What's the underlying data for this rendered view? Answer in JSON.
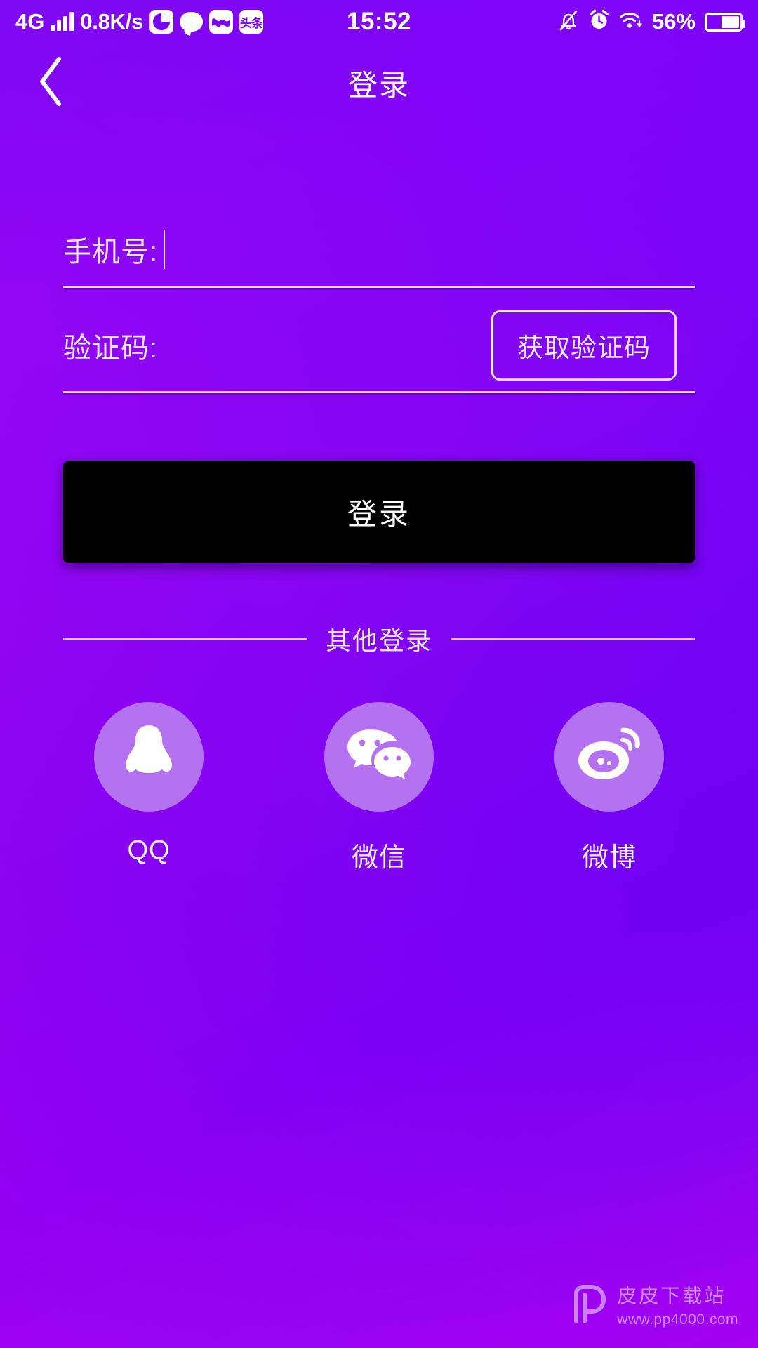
{
  "status_bar": {
    "network_type": "4G",
    "signal_icon": "signal-bars-icon",
    "data_speed": "0.8K/s",
    "app_icons": [
      {
        "name": "speedometer-app-icon",
        "label": ""
      },
      {
        "name": "chat-bubble-app-icon",
        "label": ""
      },
      {
        "name": "zigzag-app-icon",
        "label": ""
      },
      {
        "name": "toutiao-app-icon",
        "label": "头条"
      }
    ],
    "time": "15:52",
    "silent_icon": "bell-muted-icon",
    "alarm_icon": "alarm-clock-icon",
    "wifi_icon": "wifi-icon",
    "battery_percent": "56%",
    "battery_icon": "battery-icon",
    "battery_level": 56
  },
  "header": {
    "back_icon": "back-chevron-icon",
    "title": "登录"
  },
  "form": {
    "phone": {
      "label": "手机号:",
      "value": "",
      "placeholder": ""
    },
    "code": {
      "label": "验证码:",
      "value": "",
      "placeholder": "",
      "get_code_button": "获取验证码"
    },
    "submit_button": "登录"
  },
  "other_login": {
    "divider_text": "其他登录",
    "items": [
      {
        "id": "qq",
        "label": "QQ",
        "icon": "qq-penguin-icon"
      },
      {
        "id": "wechat",
        "label": "微信",
        "icon": "wechat-icon"
      },
      {
        "id": "weibo",
        "label": "微博",
        "icon": "weibo-icon"
      }
    ]
  },
  "watermark": {
    "logo_icon": "pp-logo-icon",
    "site_name": "皮皮下载站",
    "url": "www.pp4000.com"
  },
  "colors": {
    "bg_top": "#6C00F4",
    "bg_bottom": "#A300F0",
    "accent_white": "#FFFFFF",
    "social_circle": "#B572F0",
    "login_button": "#000000"
  }
}
